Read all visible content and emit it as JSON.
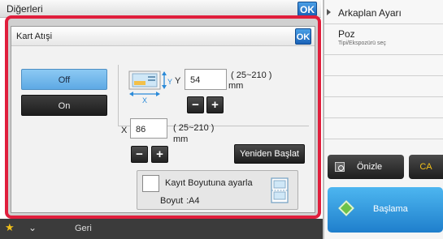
{
  "background": {
    "title": "Diğerleri",
    "ok_label": "OK",
    "right_panel": {
      "item1": "Arkaplan Ayarı",
      "item2_title": "Poz",
      "item2_sub": "Tipi/Ekspozürü seç"
    },
    "preview_label": "Önizle",
    "ca_label": "CA",
    "start_label": "Başlama",
    "bottom_back_label": "Geri"
  },
  "dialog": {
    "title": "Kart Atışi",
    "ok_label": "OK",
    "off_label": "Off",
    "on_label": "On",
    "selected": "Off",
    "y": {
      "label": "Y",
      "value": "54",
      "range": "( 25~210 )",
      "unit": "mm"
    },
    "x": {
      "label": "X",
      "value": "86",
      "range": "( 25~210 )",
      "unit": "mm"
    },
    "minus_label": "−",
    "plus_label": "+",
    "reset_label": "Yeniden Başlat",
    "fit": {
      "label": "Kayıt Boyutuna ayarla",
      "checked": false,
      "size_label": "Boyut",
      "size_value": ":A4"
    }
  },
  "colors": {
    "highlight": "#e01e3c",
    "accent_blue": "#1a62b8",
    "selected_blue": "#8cc9f3",
    "ca_yellow": "#f2c11a"
  },
  "icons": [
    "card-position-icon",
    "paper-size-icon",
    "preview-icon",
    "start-icon",
    "favorite-star-icon",
    "collapse-chevron-icon",
    "panel-arrow-icon"
  ]
}
